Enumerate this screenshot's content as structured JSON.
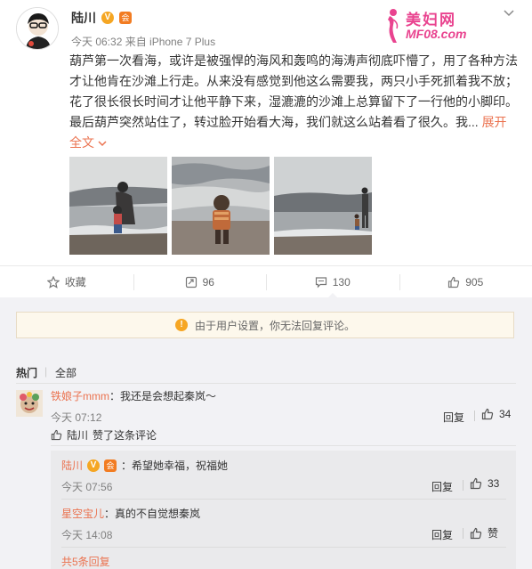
{
  "post": {
    "author": "陆川",
    "verified_badge": "V",
    "member_badge": "会",
    "meta": "今天 06:32 来自 iPhone 7 Plus",
    "text": "葫芦第一次看海，或许是被强悍的海风和轰鸣的海涛声彻底吓懵了，用了各种方法才让他肯在沙滩上行走。从来没有感觉到他这么需要我，两只小手死抓着我不放；花了很长很长时间才让他平静下来，湿漉漉的沙滩上总算留下了一行他的小脚印。最后葫芦突然站住了，转过脸开始看大海，我们就这么站着看了很久。我...",
    "expand_label": "展开全文",
    "expand_icon": "chevron-down-icon",
    "more_icon": "chevron-down-icon",
    "images": [
      "photo-beach-mother-child",
      "photo-child-walking-waves",
      "photo-adult-child-shore"
    ]
  },
  "watermark": {
    "title": "美妇网",
    "site": "MF08.com",
    "logo_icon": "lady-silhouette-icon"
  },
  "actions": {
    "favorite_label": "收藏",
    "repost_count": "96",
    "comment_count": "130",
    "like_count": "905"
  },
  "notice": {
    "text": "由于用户设置，你无法回复评论。",
    "icon": "warning-icon"
  },
  "tabs": {
    "hot": "热门",
    "all": "全部"
  },
  "comments": {
    "c1": {
      "user": "铁娘子mmm",
      "text": "：我还是会想起秦岚～",
      "time": "今天 07:12",
      "reply_label": "回复",
      "like_count": "34",
      "liked_by": "陆川",
      "liked_text": "赞了这条评论"
    },
    "r1": {
      "user": "陆川",
      "verified_badge": "V",
      "member_badge": "会",
      "text": "：希望她幸福，祝福她",
      "time": "今天 07:56",
      "reply_label": "回复",
      "like_count": "33"
    },
    "r2": {
      "user": "星空宝儿",
      "text": "：真的不自觉想秦岚",
      "time": "今天 14:08",
      "reply_label": "回复",
      "like_label": "赞"
    },
    "more_replies": "共5条回复"
  },
  "colors": {
    "accent": "#eb7350",
    "watermark": "#e9438f",
    "badge": "#f5a623"
  }
}
